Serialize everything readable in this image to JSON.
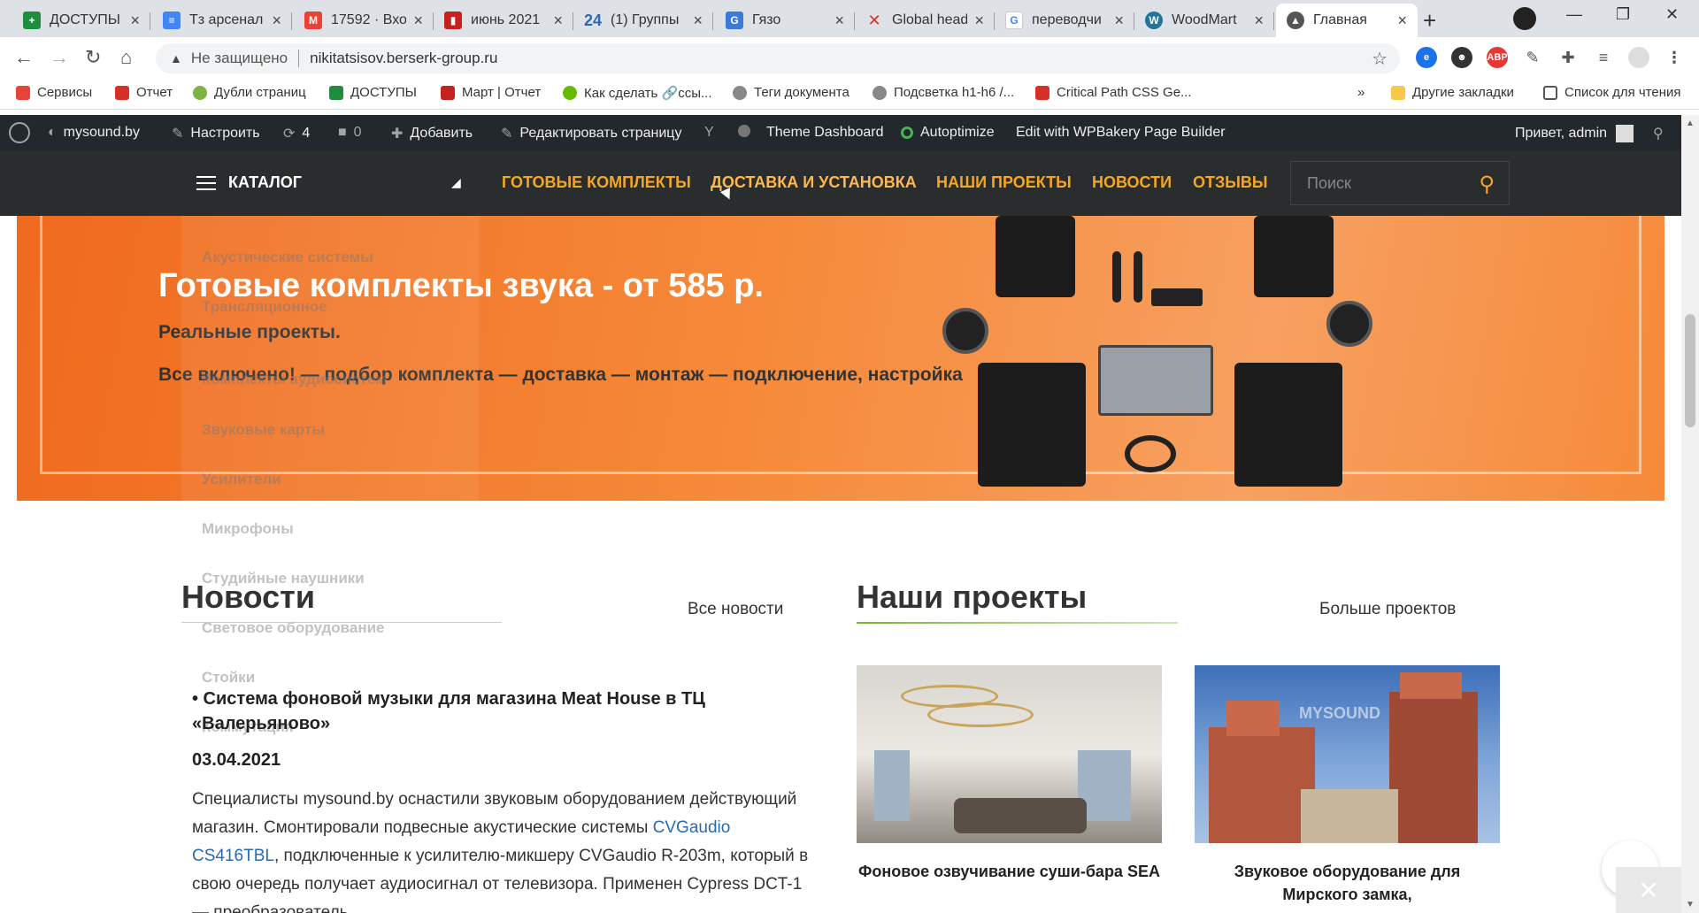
{
  "tabs": [
    {
      "title": "ДОСТУПЫ",
      "icon": "sheets-icon",
      "color": "#1e8e3e"
    },
    {
      "title": "Тз арсенал",
      "icon": "docs-icon",
      "color": "#4285f4"
    },
    {
      "title": "17592 · Вхо",
      "icon": "gmail-icon",
      "color": "#ea4335"
    },
    {
      "title": "июнь 2021",
      "icon": "app-icon",
      "color": "#c5221f"
    },
    {
      "title": "(1) Группы",
      "icon": "24-icon",
      "color": "#2a6ab0"
    },
    {
      "title": "Гязо",
      "icon": "gyazo-icon",
      "color": "#3a7bd5"
    },
    {
      "title": "Global head",
      "icon": "xenu-icon",
      "color": "#d93025"
    },
    {
      "title": "переводчи",
      "icon": "google-icon",
      "color": "#4285f4"
    },
    {
      "title": "WoodMart",
      "icon": "wordpress-icon",
      "color": "#21759b"
    },
    {
      "title": "Главная",
      "icon": "site-icon",
      "color": "#555555"
    }
  ],
  "address": {
    "security": "Не защищено",
    "url": "nikitatsisov.berserk-group.ru"
  },
  "bookmarks": [
    "Сервисы",
    "Отчет",
    "Дубли страниц",
    "ДОСТУПЫ",
    "Март | Отчет",
    "Как сделать 🔗ссы...",
    "Теги документа",
    "Подсветка h1-h6 /...",
    "Critical Path CSS Ge..."
  ],
  "bookmarks_right": {
    "more": "»",
    "other": "Другие закладки",
    "reading": "Список для чтения"
  },
  "wp": {
    "site": "mysound.by",
    "customize": "Настроить",
    "updates": "4",
    "comments": "0",
    "add": "Добавить",
    "edit": "Редактировать страницу",
    "theme": "Theme Dashboard",
    "autoptimize": "Autoptimize",
    "wpbakery": "Edit with WPBakery Page Builder",
    "greeting": "Привет, admin"
  },
  "nav": {
    "catalog": "КАТАЛОГ",
    "links": [
      "ГОТОВЫЕ КОМПЛЕКТЫ",
      "ДОСТАВКА И УСТАНОВКА",
      "НАШИ ПРОЕКТЫ",
      "НОВОСТИ",
      "ОТЗЫВЫ"
    ],
    "search_placeholder": "Поиск"
  },
  "banner": {
    "title": "Готовые комплекты звука - от 585 р.",
    "subtitle": "Реальные проекты.",
    "text": "Все включено! — подбор комплекта — доставка — монтаж — подключение, настройка"
  },
  "dropdown": [
    "Акустические системы",
    "Трансляционное",
    "Комплекты аудиосистем",
    "Звуковые карты",
    "Усилители",
    "Микрофоны",
    "Студийные наушники",
    "Световое оборудование",
    "Стойки",
    "Коммутация"
  ],
  "news": {
    "heading": "Новости",
    "all": "Все новости",
    "title": "• Система фоновой музыки для магазина Meat House в ТЦ «Валерьяново»",
    "date": "03.04.2021",
    "body_1": "Специалисты mysound.by оснастили звуковым оборудованием действующий магазин. Смонтировали подвесные акустические системы ",
    "body_link": "CVGaudio CS416TBL",
    "body_2": ", подключенные к усилителю-микшеру CVGaudio R-203m, который в свою очередь получает аудиосигнал от телевизора. Применен Cypress DCT-1 — преобразователь"
  },
  "projects": {
    "heading": "Наши проекты",
    "more": "Больше проектов",
    "items": [
      {
        "caption": "Фоновое озвучивание суши-бара SEA"
      },
      {
        "caption": "Звуковое оборудование для Мирского замка,",
        "watermark": "MYSOUND"
      }
    ]
  }
}
